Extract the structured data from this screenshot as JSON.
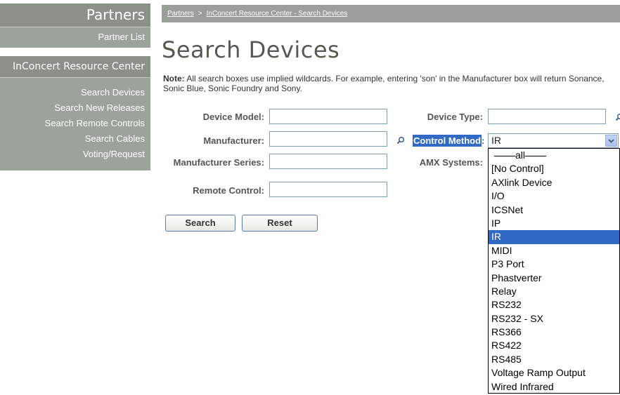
{
  "sidebar": {
    "header": "Partners",
    "partner_list": "Partner List",
    "section_title": "InConcert Resource Center",
    "items": [
      {
        "label": "Search Devices"
      },
      {
        "label": "Search New Releases"
      },
      {
        "label": "Search Remote Controls"
      },
      {
        "label": "Search Cables"
      },
      {
        "label": "Voting/Request"
      }
    ]
  },
  "breadcrumb": {
    "items": [
      "Partners",
      "InConcert Resource Center - Search Devices"
    ],
    "separator": ">"
  },
  "main": {
    "title": "Search Devices",
    "note_bold": "Note:",
    "note_text": " All search boxes use implied wildcards. For example, entering 'son' in the Manufacturer box will return Sonance, Sonic Blue, Sonic Foundry and Sony."
  },
  "form": {
    "device_model": {
      "label": "Device Model:",
      "value": ""
    },
    "manufacturer": {
      "label": "Manufacturer:",
      "value": ""
    },
    "manufacturer_series": {
      "label": "Manufacturer Series:",
      "value": ""
    },
    "remote_control": {
      "label": "Remote Control:",
      "value": ""
    },
    "device_type": {
      "label": "Device Type:",
      "value": ""
    },
    "control_method": {
      "label": "Control Method",
      "label_suffix": ":",
      "selected": "IR"
    },
    "amx_systems": {
      "label": "AMX Systems:"
    }
  },
  "buttons": {
    "search": "Search",
    "reset": "Reset"
  },
  "dropdown": {
    "options": [
      "all",
      "[No Control]",
      "AXlink Device",
      "I/O",
      "ICSNet",
      "IP",
      "IR",
      "MIDI",
      "P3 Port",
      "Phastverter",
      "Relay",
      "RS232",
      "RS232 - SX",
      "RS366",
      "RS422",
      "RS485",
      "Voltage Ramp Output",
      "Wired Infrared"
    ],
    "highlighted": "IR"
  },
  "colors": {
    "sidebar_dark": "#8b9089",
    "sidebar_light": "#9ba39a",
    "selection": "#316ac5",
    "input_border": "#7f9db9"
  },
  "icons": [
    "magnifier-icon",
    "chevron-down-icon"
  ]
}
